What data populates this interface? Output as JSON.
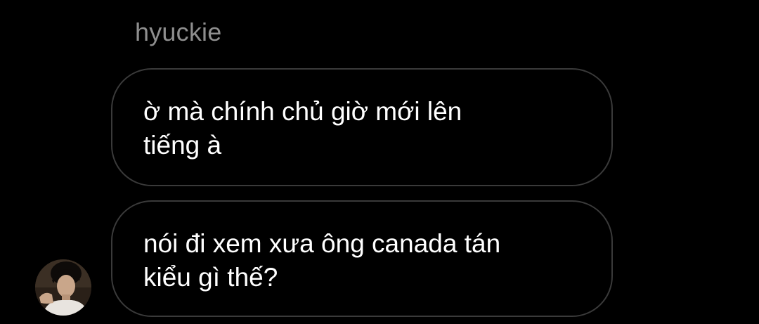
{
  "thread": {
    "sender_name": "hyuckie",
    "messages": [
      {
        "text": "ờ mà chính chủ giờ mới lên\ntiếng à"
      },
      {
        "text": "nói đi xem xưa ông canada tán\nkiểu gì thế?"
      }
    ]
  },
  "colors": {
    "background": "#000000",
    "bubble_border": "#3a3a3a",
    "message_text": "#ffffff",
    "sender_name": "#8e8e8e"
  },
  "icons": {
    "avatar": "profile-photo"
  }
}
